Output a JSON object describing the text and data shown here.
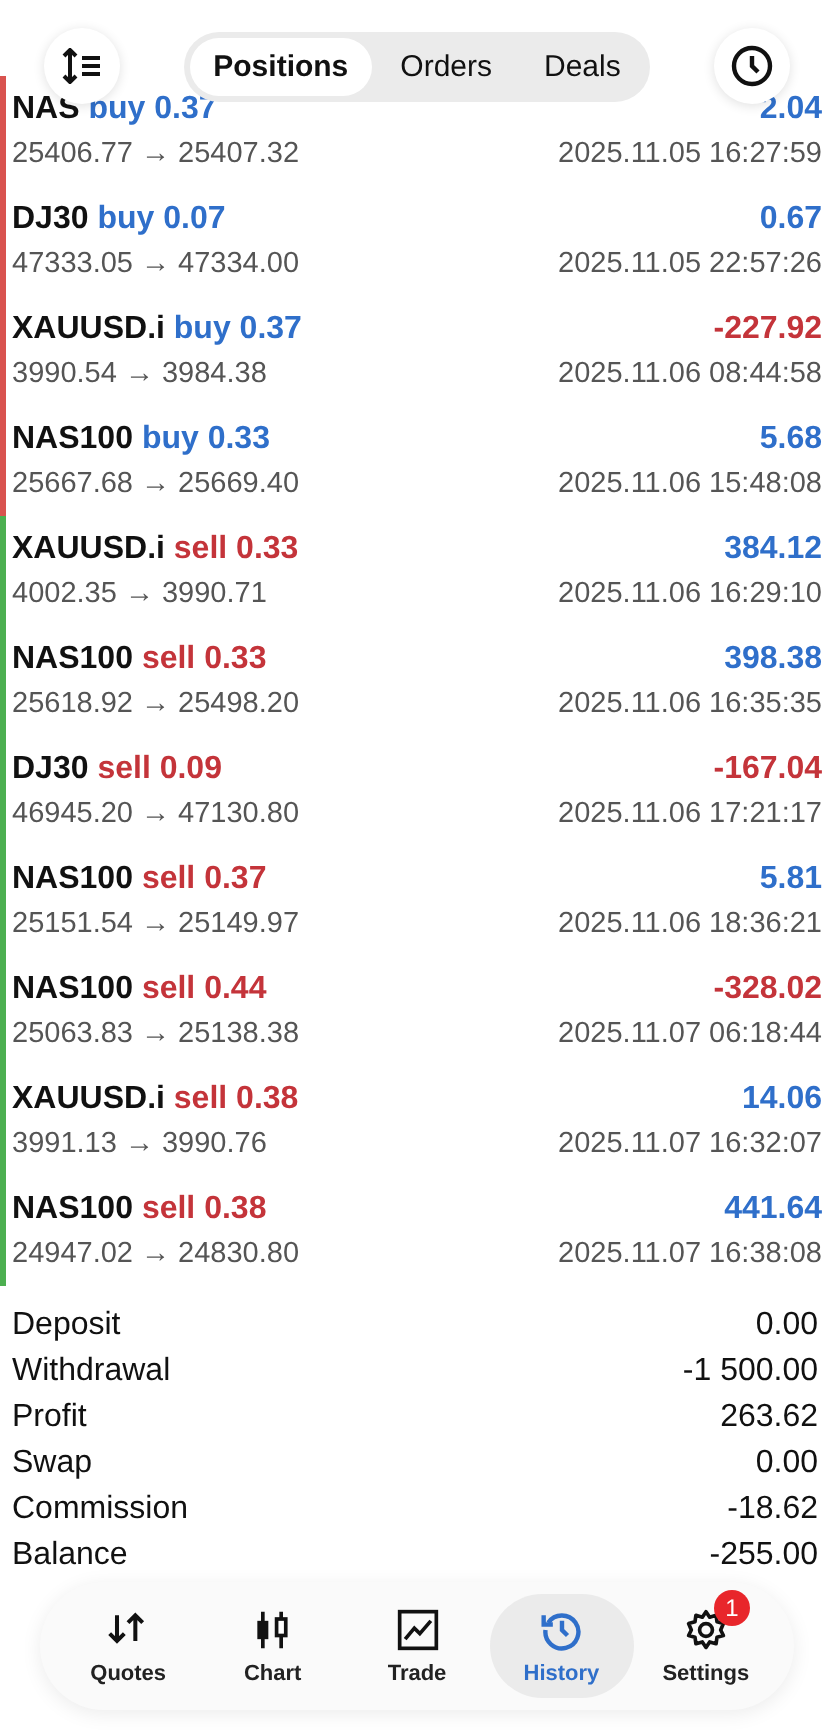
{
  "header": {
    "tabs": [
      {
        "label": "Positions",
        "selected": true
      },
      {
        "label": "Orders",
        "selected": false
      },
      {
        "label": "Deals",
        "selected": false
      }
    ]
  },
  "deals": [
    {
      "symbol": "NAS",
      "kind": "buy",
      "volume": "buy 0.37",
      "profit": "2.04",
      "loss": false,
      "prices": "25406.77 → 25407.32",
      "time": "2025.11.05 16:27:59",
      "color": "#d9534f"
    },
    {
      "symbol": "DJ30",
      "kind": "buy",
      "volume": "buy 0.07",
      "profit": "0.67",
      "loss": false,
      "prices": "47333.05 → 47334.00",
      "time": "2025.11.05 22:57:26",
      "color": "#d9534f"
    },
    {
      "symbol": "XAUUSD.i",
      "kind": "buy",
      "volume": "buy 0.37",
      "profit": "-227.92",
      "loss": true,
      "prices": "3990.54 → 3984.38",
      "time": "2025.11.06 08:44:58",
      "color": "#d9534f"
    },
    {
      "symbol": "NAS100",
      "kind": "buy",
      "volume": "buy 0.33",
      "profit": "5.68",
      "loss": false,
      "prices": "25667.68 → 25669.40",
      "time": "2025.11.06 15:48:08",
      "color": "#d9534f"
    },
    {
      "symbol": "XAUUSD.i",
      "kind": "sell",
      "volume": "sell 0.33",
      "profit": "384.12",
      "loss": false,
      "prices": "4002.35 → 3990.71",
      "time": "2025.11.06 16:29:10",
      "color": "#4caf50"
    },
    {
      "symbol": "NAS100",
      "kind": "sell",
      "volume": "sell 0.33",
      "profit": "398.38",
      "loss": false,
      "prices": "25618.92 → 25498.20",
      "time": "2025.11.06 16:35:35",
      "color": "#4caf50"
    },
    {
      "symbol": "DJ30",
      "kind": "sell",
      "volume": "sell 0.09",
      "profit": "-167.04",
      "loss": true,
      "prices": "46945.20 → 47130.80",
      "time": "2025.11.06 17:21:17",
      "color": "#4caf50"
    },
    {
      "symbol": "NAS100",
      "kind": "sell",
      "volume": "sell 0.37",
      "profit": "5.81",
      "loss": false,
      "prices": "25151.54 → 25149.97",
      "time": "2025.11.06 18:36:21",
      "color": "#4caf50"
    },
    {
      "symbol": "NAS100",
      "kind": "sell",
      "volume": "sell 0.44",
      "profit": "-328.02",
      "loss": true,
      "prices": "25063.83 → 25138.38",
      "time": "2025.11.07 06:18:44",
      "color": "#4caf50"
    },
    {
      "symbol": "XAUUSD.i",
      "kind": "sell",
      "volume": "sell 0.38",
      "profit": "14.06",
      "loss": false,
      "prices": "3991.13 → 3990.76",
      "time": "2025.11.07 16:32:07",
      "color": "#4caf50"
    },
    {
      "symbol": "NAS100",
      "kind": "sell",
      "volume": "sell 0.38",
      "profit": "441.64",
      "loss": false,
      "prices": "24947.02 → 24830.80",
      "time": "2025.11.07 16:38:08",
      "color": "#4caf50"
    }
  ],
  "summary": [
    {
      "label": "Deposit",
      "value": "0.00"
    },
    {
      "label": "Withdrawal",
      "value": "-1 500.00"
    },
    {
      "label": "Profit",
      "value": "263.62"
    },
    {
      "label": "Swap",
      "value": "0.00"
    },
    {
      "label": "Commission",
      "value": "-18.62"
    },
    {
      "label": "Balance",
      "value": "-255.00"
    }
  ],
  "nav": [
    {
      "kind": "quotes",
      "label": "Quotes",
      "selected": false
    },
    {
      "kind": "chart",
      "label": "Chart",
      "selected": false
    },
    {
      "kind": "trade",
      "label": "Trade",
      "selected": false
    },
    {
      "kind": "history",
      "label": "History",
      "selected": true
    },
    {
      "kind": "settings",
      "label": "Settings",
      "selected": false,
      "badge": "1"
    }
  ]
}
